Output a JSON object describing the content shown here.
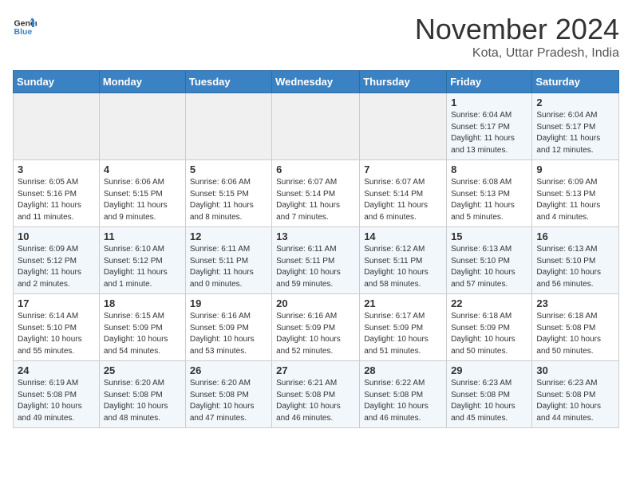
{
  "header": {
    "logo_line1": "General",
    "logo_line2": "Blue",
    "month_title": "November 2024",
    "location": "Kota, Uttar Pradesh, India"
  },
  "days_of_week": [
    "Sunday",
    "Monday",
    "Tuesday",
    "Wednesday",
    "Thursday",
    "Friday",
    "Saturday"
  ],
  "weeks": [
    [
      {
        "day": "",
        "info": ""
      },
      {
        "day": "",
        "info": ""
      },
      {
        "day": "",
        "info": ""
      },
      {
        "day": "",
        "info": ""
      },
      {
        "day": "",
        "info": ""
      },
      {
        "day": "1",
        "info": "Sunrise: 6:04 AM\nSunset: 5:17 PM\nDaylight: 11 hours\nand 13 minutes."
      },
      {
        "day": "2",
        "info": "Sunrise: 6:04 AM\nSunset: 5:17 PM\nDaylight: 11 hours\nand 12 minutes."
      }
    ],
    [
      {
        "day": "3",
        "info": "Sunrise: 6:05 AM\nSunset: 5:16 PM\nDaylight: 11 hours\nand 11 minutes."
      },
      {
        "day": "4",
        "info": "Sunrise: 6:06 AM\nSunset: 5:15 PM\nDaylight: 11 hours\nand 9 minutes."
      },
      {
        "day": "5",
        "info": "Sunrise: 6:06 AM\nSunset: 5:15 PM\nDaylight: 11 hours\nand 8 minutes."
      },
      {
        "day": "6",
        "info": "Sunrise: 6:07 AM\nSunset: 5:14 PM\nDaylight: 11 hours\nand 7 minutes."
      },
      {
        "day": "7",
        "info": "Sunrise: 6:07 AM\nSunset: 5:14 PM\nDaylight: 11 hours\nand 6 minutes."
      },
      {
        "day": "8",
        "info": "Sunrise: 6:08 AM\nSunset: 5:13 PM\nDaylight: 11 hours\nand 5 minutes."
      },
      {
        "day": "9",
        "info": "Sunrise: 6:09 AM\nSunset: 5:13 PM\nDaylight: 11 hours\nand 4 minutes."
      }
    ],
    [
      {
        "day": "10",
        "info": "Sunrise: 6:09 AM\nSunset: 5:12 PM\nDaylight: 11 hours\nand 2 minutes."
      },
      {
        "day": "11",
        "info": "Sunrise: 6:10 AM\nSunset: 5:12 PM\nDaylight: 11 hours\nand 1 minute."
      },
      {
        "day": "12",
        "info": "Sunrise: 6:11 AM\nSunset: 5:11 PM\nDaylight: 11 hours\nand 0 minutes."
      },
      {
        "day": "13",
        "info": "Sunrise: 6:11 AM\nSunset: 5:11 PM\nDaylight: 10 hours\nand 59 minutes."
      },
      {
        "day": "14",
        "info": "Sunrise: 6:12 AM\nSunset: 5:11 PM\nDaylight: 10 hours\nand 58 minutes."
      },
      {
        "day": "15",
        "info": "Sunrise: 6:13 AM\nSunset: 5:10 PM\nDaylight: 10 hours\nand 57 minutes."
      },
      {
        "day": "16",
        "info": "Sunrise: 6:13 AM\nSunset: 5:10 PM\nDaylight: 10 hours\nand 56 minutes."
      }
    ],
    [
      {
        "day": "17",
        "info": "Sunrise: 6:14 AM\nSunset: 5:10 PM\nDaylight: 10 hours\nand 55 minutes."
      },
      {
        "day": "18",
        "info": "Sunrise: 6:15 AM\nSunset: 5:09 PM\nDaylight: 10 hours\nand 54 minutes."
      },
      {
        "day": "19",
        "info": "Sunrise: 6:16 AM\nSunset: 5:09 PM\nDaylight: 10 hours\nand 53 minutes."
      },
      {
        "day": "20",
        "info": "Sunrise: 6:16 AM\nSunset: 5:09 PM\nDaylight: 10 hours\nand 52 minutes."
      },
      {
        "day": "21",
        "info": "Sunrise: 6:17 AM\nSunset: 5:09 PM\nDaylight: 10 hours\nand 51 minutes."
      },
      {
        "day": "22",
        "info": "Sunrise: 6:18 AM\nSunset: 5:09 PM\nDaylight: 10 hours\nand 50 minutes."
      },
      {
        "day": "23",
        "info": "Sunrise: 6:18 AM\nSunset: 5:08 PM\nDaylight: 10 hours\nand 50 minutes."
      }
    ],
    [
      {
        "day": "24",
        "info": "Sunrise: 6:19 AM\nSunset: 5:08 PM\nDaylight: 10 hours\nand 49 minutes."
      },
      {
        "day": "25",
        "info": "Sunrise: 6:20 AM\nSunset: 5:08 PM\nDaylight: 10 hours\nand 48 minutes."
      },
      {
        "day": "26",
        "info": "Sunrise: 6:20 AM\nSunset: 5:08 PM\nDaylight: 10 hours\nand 47 minutes."
      },
      {
        "day": "27",
        "info": "Sunrise: 6:21 AM\nSunset: 5:08 PM\nDaylight: 10 hours\nand 46 minutes."
      },
      {
        "day": "28",
        "info": "Sunrise: 6:22 AM\nSunset: 5:08 PM\nDaylight: 10 hours\nand 46 minutes."
      },
      {
        "day": "29",
        "info": "Sunrise: 6:23 AM\nSunset: 5:08 PM\nDaylight: 10 hours\nand 45 minutes."
      },
      {
        "day": "30",
        "info": "Sunrise: 6:23 AM\nSunset: 5:08 PM\nDaylight: 10 hours\nand 44 minutes."
      }
    ]
  ]
}
